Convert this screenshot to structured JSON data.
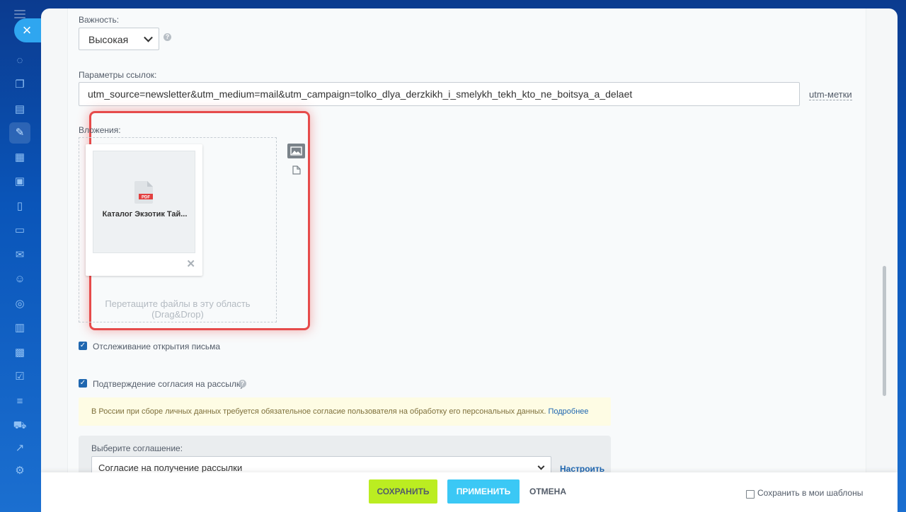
{
  "colors": {
    "accent_blue": "#2067b0",
    "save_green": "#bbed21",
    "apply_blue": "#3bc8f5",
    "highlight_red": "#e64b4b"
  },
  "rail": {
    "close_label": "×",
    "icons": [
      "activity-icon",
      "chat-icon",
      "document-icon",
      "marketing-icon",
      "calendar-icon",
      "contacts-icon",
      "file-icon",
      "sites-icon",
      "mail-icon",
      "users-icon",
      "tasks-icon",
      "notebook-icon",
      "crm-icon",
      "checklist-icon",
      "filter-icon",
      "cart-icon",
      "chart-icon",
      "settings-icon"
    ]
  },
  "form": {
    "importance": {
      "label": "Важность:",
      "value": "Высокая"
    },
    "link_params": {
      "label": "Параметры ссылок:",
      "value": "utm_source=newsletter&utm_medium=mail&utm_campaign=tolko_dlya_derzkikh_i_smelykh_tekh_kto_ne_boitsya_a_delaet",
      "utm_link": "utm-метки"
    },
    "attachments": {
      "label": "Вложения:",
      "file_name": "Каталог Экзотик Тай...",
      "file_type": "PDF",
      "drop_hint": "Перетащите файлы в эту область (Drag&Drop)"
    },
    "tracking": {
      "label": "Отслеживание открытия письма",
      "checked": true
    },
    "consent": {
      "label": "Подтверждение согласия на рассылку",
      "checked": true,
      "notice": "В России при сборе личных данных требуется обязательное согласие пользователя на обработку его персональных данных.",
      "notice_link": "Подробнее"
    },
    "agreement": {
      "label": "Выберите соглашение:",
      "value": "Согласие на получение рассылки",
      "configure_link": "Настроить"
    }
  },
  "footer": {
    "save": "СОХРАНИТЬ",
    "apply": "ПРИМЕНИТЬ",
    "cancel": "ОТМЕНА",
    "save_template": "Сохранить в мои шаблоны"
  }
}
